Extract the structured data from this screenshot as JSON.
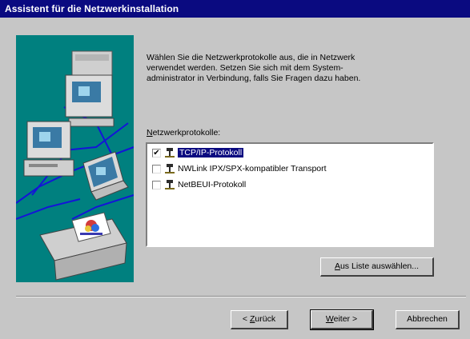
{
  "window": {
    "title": "Assistent für die Netzwerkinstallation"
  },
  "intro": {
    "lines": [
      "Wählen Sie die Netzwerkprotokolle aus, die in Netzwerk",
      "verwendet werden. Setzen Sie sich mit dem System-",
      "administrator in Verbindung, falls Sie Fragen dazu haben."
    ]
  },
  "protocols": {
    "label_underlined": "N",
    "label_rest": "etzwerkprotokolle:",
    "items": [
      {
        "label": "TCP/IP-Protokoll",
        "checked": true,
        "selected": true
      },
      {
        "label": "NWLink IPX/SPX-kompatibler Transport",
        "checked": false,
        "selected": false
      },
      {
        "label": "NetBEUI-Protokoll",
        "checked": false,
        "selected": false
      }
    ]
  },
  "buttons": {
    "choose_underlined": "A",
    "choose_rest": "us Liste auswählen...",
    "back_prefix": "< ",
    "back_underlined": "Z",
    "back_rest": "urück",
    "next_underlined": "W",
    "next_rest": "eiter >",
    "cancel": "Abbrechen"
  },
  "colors": {
    "titlebar": "#0a0a80",
    "art_background": "#00807f",
    "selection": "#0a0a80",
    "dialog_face": "#c6c6c6"
  }
}
